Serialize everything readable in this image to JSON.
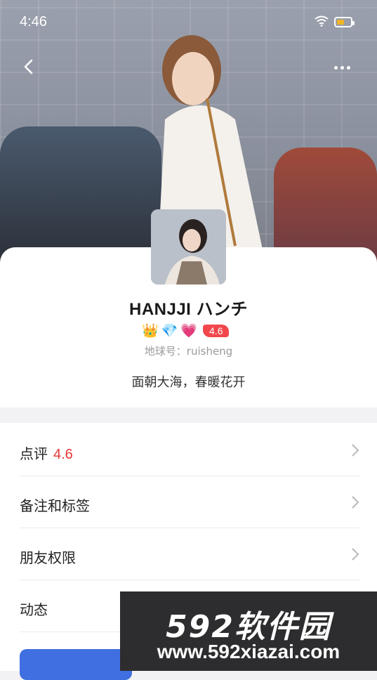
{
  "status_bar": {
    "time": "4:46",
    "wifi_icon": "wifi-icon",
    "battery_icon": "battery-icon"
  },
  "header": {
    "back_icon": "chevron-left-icon",
    "more_icon": "more-horizontal-icon"
  },
  "profile": {
    "name": "HANJJI ハンチ",
    "badges": [
      {
        "icon": "crown-icon",
        "glyph": "👑"
      },
      {
        "icon": "diamond-icon",
        "glyph": "💎"
      },
      {
        "icon": "heart-icon",
        "glyph": "💗"
      }
    ],
    "rating": "4.6",
    "earth_id": "地球号：ruisheng",
    "signature": "面朝大海，春暖花开"
  },
  "menu": [
    {
      "label": "点评",
      "value": "4.6"
    },
    {
      "label": "备注和标签"
    },
    {
      "label": "朋友权限"
    },
    {
      "label": "动态"
    }
  ],
  "watermark": {
    "brand": "592软件园",
    "url": "www.592xiazai.com"
  },
  "colors": {
    "rating_red": "#e53935",
    "primary_blue": "#3f6fe0",
    "battery": "#f0b429"
  }
}
